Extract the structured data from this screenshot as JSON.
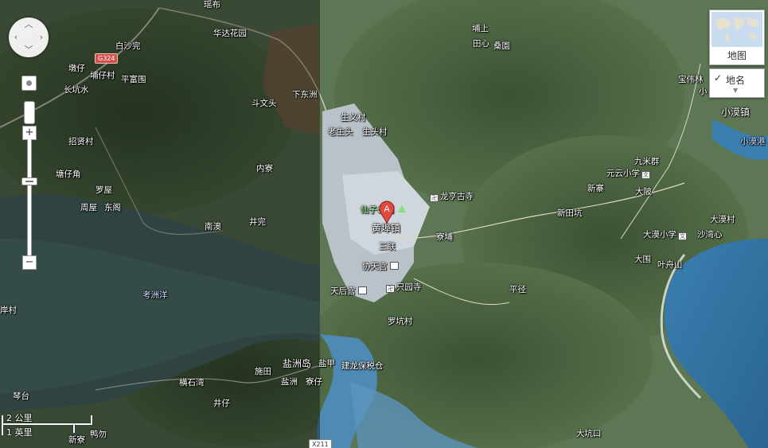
{
  "map": {
    "marker_letter": "A",
    "colors": {
      "water": "#2f6f9e",
      "land_dark": "#3c4a34",
      "urban": "#b9c2c9",
      "marker": "#e04a3e",
      "shield": "#d2514a"
    }
  },
  "roads": {
    "g324": "G324",
    "x211": "X211"
  },
  "places": {
    "yaobu": "瑶布",
    "baisha": "白沙完",
    "huada": "华达花园",
    "dunzi": "墩仔",
    "puzicun": "埔仔村",
    "pingfu": "平富围",
    "changkeng": "长坑水",
    "xiadongzhou": "下东洲",
    "douwentou": "斗文头",
    "zhaoxian": "招贤村",
    "neiliao": "内寮",
    "tangzijiao": "塘仔角",
    "luowu": "罗屋",
    "zhouwu": "周屋",
    "dongge": "东阁",
    "nanao": "南澳",
    "jingwan": "井完",
    "kaozhouyang": "考洲洋",
    "anzicun": "岸村",
    "yanzhoudao": "盐洲岛",
    "yanzhou": "盐洲",
    "shitian": "施田",
    "liaozi": "寮仔",
    "hengshiwan": "横石湾",
    "jingzi": "井仔",
    "qintai": "琴台",
    "xinliao": "新寮",
    "yagou": "鸭勿",
    "shenggui": "盐甲",
    "jianlong": "建龙保税仓",
    "pushang": "埔上",
    "tianxin": "田心",
    "sangyuan": "桑園",
    "shengyicun": "生义村",
    "laoshengtou": "老生头",
    "shengtoucun": "生头村",
    "xianzi": "仙子公园",
    "longheng": "龙亨古寺",
    "huangbu": "黄埠镇",
    "sanlian": "三联",
    "liaopu": "寮埔",
    "xietiangong": "协天宫",
    "tianhougong": "天后宫",
    "zhiyuansi": "只园寺",
    "pingjing": "平径",
    "luokengcun": "罗坑村",
    "jiumiqun": "九米群",
    "yuanyun": "元云小学",
    "xinliao2": "新寨",
    "dabei": "大陂",
    "xintiankeng": "新田坑",
    "baochang": "宝伟林",
    "xiaomozhen": "小漠镇",
    "xiaomogang": "小漠港",
    "damo": "大漠村",
    "damoxx": "大漠小学",
    "shawei": "沙湾心",
    "daxing": "大围",
    "yezhoushan": "叶舟山",
    "dakengkou": "大坑口",
    "xiao": "小"
  },
  "controls": {
    "map_type_label": "地图",
    "labels_toggle": "地名",
    "labels_checked": true
  },
  "scale": {
    "metric": "2 公里",
    "imperial": "1 英里"
  }
}
